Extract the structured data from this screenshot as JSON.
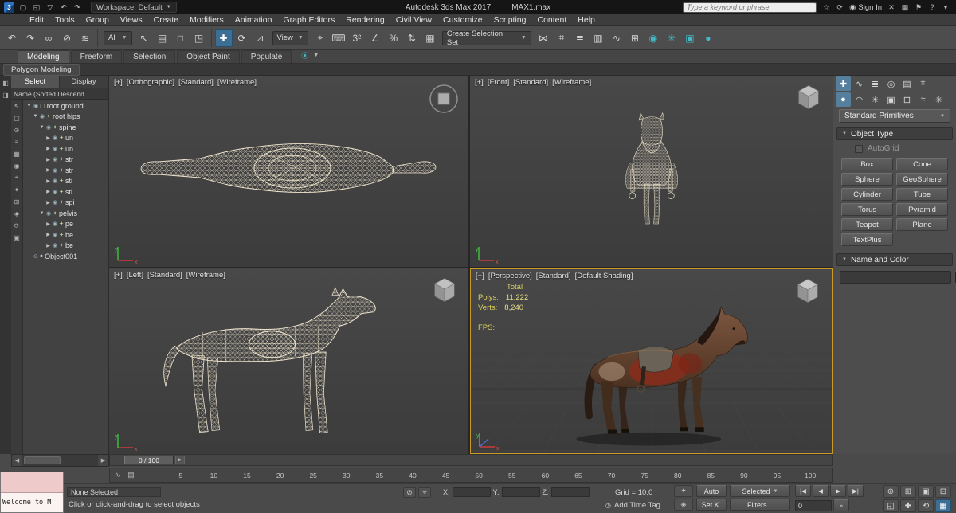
{
  "colors": {
    "active_viewport_border": "#c99b26",
    "wireframe": "#efe4cd",
    "stats_text": "#ddd25e",
    "name_color_swatch": "#e8559c"
  },
  "title_bar": {
    "logo_text": "3",
    "workspace_label": "Workspace: Default",
    "app_title": "Autodesk 3ds Max 2017",
    "file_name": "MAX1.max",
    "search_placeholder": "Type a keyword or phrase",
    "sign_in_label": "Sign In",
    "quick_icons": [
      {
        "name": "new-file-icon",
        "glyph": "▢"
      },
      {
        "name": "open-file-icon",
        "glyph": "◱"
      },
      {
        "name": "save-icon",
        "glyph": "▽"
      },
      {
        "name": "undo-quick-icon",
        "glyph": "↶"
      },
      {
        "name": "redo-quick-icon",
        "glyph": "↷"
      }
    ],
    "right_icons": [
      {
        "name": "favorites-icon",
        "glyph": "☆"
      },
      {
        "name": "sync-icon",
        "glyph": "⟳"
      }
    ],
    "right_icons2": [
      {
        "name": "exchange-icon",
        "glyph": "✕"
      },
      {
        "name": "apps-icon",
        "glyph": "▦"
      },
      {
        "name": "notification-icon",
        "glyph": "⚑"
      },
      {
        "name": "help-icon",
        "glyph": "?"
      },
      {
        "name": "title-dropdown-icon",
        "glyph": "▾"
      }
    ]
  },
  "menu_bar": {
    "items": [
      "Edit",
      "Tools",
      "Group",
      "Views",
      "Create",
      "Modifiers",
      "Animation",
      "Graph Editors",
      "Rendering",
      "Civil View",
      "Customize",
      "Scripting",
      "Content",
      "Help"
    ]
  },
  "toolbar": {
    "selection_filter_value": "All",
    "view_value": "View",
    "selection_set_value": "Create Selection Set",
    "icons_a": [
      {
        "name": "undo-icon",
        "glyph": "↶"
      },
      {
        "name": "redo-icon",
        "glyph": "↷"
      },
      {
        "name": "select-and-link-icon",
        "glyph": "∞"
      },
      {
        "name": "unlink-selection-icon",
        "glyph": "⊘"
      },
      {
        "name": "bind-to-space-warp-icon",
        "glyph": "≋"
      }
    ],
    "icons_b": [
      {
        "name": "select-object-icon",
        "glyph": "↖"
      },
      {
        "name": "select-by-name-icon",
        "glyph": "▤"
      },
      {
        "name": "selection-region-icon",
        "glyph": "□"
      },
      {
        "name": "window-crossing-icon",
        "glyph": "◳"
      }
    ],
    "icons_c": [
      {
        "name": "select-and-move-icon",
        "glyph": "✚",
        "cls": "active"
      },
      {
        "name": "select-and-rotate-icon",
        "glyph": "⟳"
      },
      {
        "name": "select-and-scale-icon",
        "glyph": "⊿"
      }
    ],
    "icons_d": [
      {
        "name": "select-and-manipulate-icon",
        "glyph": "⌖"
      },
      {
        "name": "keyboard-override-icon",
        "glyph": "⌨"
      },
      {
        "name": "snap-toggle-3d-icon",
        "glyph": "3²"
      },
      {
        "name": "angle-snap-icon",
        "glyph": "∠"
      },
      {
        "name": "percent-snap-icon",
        "glyph": "%"
      },
      {
        "name": "spinner-snap-icon",
        "glyph": "⇅"
      },
      {
        "name": "named-selection-sets-icon",
        "glyph": "▦"
      }
    ],
    "icons_e": [
      {
        "name": "mirror-icon",
        "glyph": "⋈"
      },
      {
        "name": "align-icon",
        "glyph": "⌗"
      },
      {
        "name": "layer-manager-icon",
        "glyph": "≣"
      },
      {
        "name": "ribbon-toggle-icon",
        "glyph": "▥"
      },
      {
        "name": "curve-editor-icon",
        "glyph": "∿"
      },
      {
        "name": "schematic-view-icon",
        "glyph": "⊞"
      },
      {
        "name": "material-editor-icon",
        "glyph": "◉",
        "cls": "teal"
      },
      {
        "name": "render-setup-icon",
        "glyph": "✳",
        "cls": "teal"
      },
      {
        "name": "rendered-frame-icon",
        "glyph": "▣",
        "cls": "teal"
      },
      {
        "name": "render-production-icon",
        "glyph": "●",
        "cls": "teal"
      }
    ]
  },
  "ribbon": {
    "tabs": [
      {
        "name": "tab-modeling",
        "label": "Modeling",
        "cls": "active"
      },
      {
        "name": "tab-freeform",
        "label": "Freeform"
      },
      {
        "name": "tab-selection",
        "label": "Selection"
      },
      {
        "name": "tab-object-paint",
        "label": "Object Paint"
      },
      {
        "name": "tab-populate",
        "label": "Populate"
      }
    ],
    "collapsed_panel": "Polygon Modeling"
  },
  "scene_explorer": {
    "tabs": [
      "Select",
      "Display"
    ],
    "column_header": "Name (Sorted Descend",
    "tools": [
      {
        "name": "explorer-select-icon",
        "glyph": "↖"
      },
      {
        "name": "explorer-rectangle-icon",
        "glyph": "▢"
      },
      {
        "name": "explorer-select-none-icon",
        "glyph": "⊘"
      },
      {
        "name": "explorer-list-icon",
        "glyph": "≡"
      },
      {
        "name": "explorer-display-icon",
        "glyph": "▦"
      },
      {
        "name": "explorer-eye-icon",
        "glyph": "◉"
      },
      {
        "name": "explorer-pick-icon",
        "glyph": "⌖"
      },
      {
        "name": "explorer-bone-filter-icon",
        "glyph": "✦"
      },
      {
        "name": "explorer-helper-filter-icon",
        "glyph": "⊞"
      },
      {
        "name": "explorer-pin-icon",
        "glyph": "◈"
      },
      {
        "name": "explorer-sync-icon",
        "glyph": "⟳"
      },
      {
        "name": "explorer-lock-icon",
        "glyph": "▣"
      }
    ],
    "rows": [
      "root ground",
      "root hips",
      "spine",
      "un",
      "un",
      "str",
      "str",
      "sti",
      "sti",
      "spi",
      "pelvis",
      "pe",
      "be",
      "be",
      "Object001"
    ]
  },
  "viewports": {
    "top_left": {
      "menus": [
        "[+]",
        "[Orthographic]",
        "[Standard]",
        "[Wireframe]"
      ]
    },
    "top_right": {
      "menus": [
        "[+]",
        "[Front]",
        "[Standard]",
        "[Wireframe]"
      ]
    },
    "bottom_left": {
      "menus": [
        "[+]",
        "[Left]",
        "[Standard]",
        "[Wireframe]"
      ]
    },
    "bottom_right": {
      "menus": [
        "[+]",
        "[Perspective]",
        "[Standard]",
        "[Default Shading]"
      ]
    },
    "stats": {
      "total_label": "Total",
      "polys_label": "Polys:",
      "polys": "11,222",
      "verts_label": "Verts:",
      "verts": "8,240",
      "fps_label": "FPS:"
    }
  },
  "command_panel": {
    "tabs": [
      {
        "name": "create-tab-icon",
        "glyph": "✚",
        "cls": "active"
      },
      {
        "name": "modify-tab-icon",
        "glyph": "∿"
      },
      {
        "name": "hierarchy-tab-icon",
        "glyph": "≣"
      },
      {
        "name": "motion-tab-icon",
        "glyph": "◎"
      },
      {
        "name": "display-tab-icon",
        "glyph": "▤"
      },
      {
        "name": "utilities-tab-icon",
        "glyph": "⌗"
      }
    ],
    "categories": [
      {
        "name": "geometry-category-icon",
        "glyph": "●",
        "cls": "active"
      },
      {
        "name": "shapes-category-icon",
        "glyph": "◠"
      },
      {
        "name": "lights-category-icon",
        "glyph": "☀"
      },
      {
        "name": "cameras-category-icon",
        "glyph": "▣"
      },
      {
        "name": "helpers-category-icon",
        "glyph": "⊞"
      },
      {
        "name": "space-warps-category-icon",
        "glyph": "≈"
      },
      {
        "name": "systems-category-icon",
        "glyph": "✳"
      }
    ],
    "dropdown_value": "Standard Primitives",
    "object_type_rollout": "Object Type",
    "autogrid_label": "AutoGrid",
    "buttons": [
      "Box",
      "Cone",
      "Sphere",
      "GeoSphere",
      "Cylinder",
      "Tube",
      "Torus",
      "Pyramid",
      "Teapot",
      "Plane",
      "TextPlus"
    ],
    "name_color_rollout": "Name and Color",
    "name_value": ""
  },
  "timeline": {
    "slider_value": "0 / 100",
    "ticks": [
      "5",
      "10",
      "15",
      "20",
      "25",
      "30",
      "35",
      "40",
      "45",
      "50",
      "55",
      "60",
      "65",
      "70",
      "75",
      "80",
      "85",
      "90",
      "95",
      "100"
    ],
    "trackbar_icons": [
      {
        "name": "mini-curve-editor-icon",
        "glyph": "∿"
      },
      {
        "name": "trackbar-filter-icon",
        "glyph": "▤"
      }
    ]
  },
  "status_bar": {
    "listener_text": "Welcome to M",
    "selection_status": "None Selected",
    "prompt": "Click or click-and-drag to select objects",
    "x_label": "X:",
    "y_label": "Y:",
    "z_label": "Z:",
    "x_value": "",
    "y_value": "",
    "z_value": "",
    "grid_label": "Grid = 10.0",
    "add_time_tag": "Add Time Tag",
    "auto_key": "Auto",
    "selected_set": "Selected",
    "set_key": "Set K.",
    "key_filters": "Filters...",
    "frame_value": "0",
    "lock_icons": [
      {
        "name": "selection-lock-icon",
        "glyph": "⊘"
      },
      {
        "name": "absolute-offset-icon",
        "glyph": "⌖"
      }
    ],
    "key_icons": [
      {
        "name": "set-keys-button",
        "glyph": "✦"
      },
      {
        "name": "key-mode-button",
        "glyph": "◈"
      }
    ],
    "playback": [
      {
        "name": "go-to-start-icon",
        "glyph": "|◀"
      },
      {
        "name": "previous-frame-icon",
        "glyph": "◀"
      },
      {
        "name": "play-icon",
        "glyph": "▶"
      },
      {
        "name": "go-to-end-icon",
        "glyph": "▶|"
      }
    ],
    "nav": [
      {
        "name": "zoom-icon",
        "glyph": "⊕"
      },
      {
        "name": "zoom-all-icon",
        "glyph": "⊞"
      },
      {
        "name": "zoom-extents-icon",
        "glyph": "▣"
      },
      {
        "name": "zoom-extents-all-icon",
        "glyph": "⊟"
      },
      {
        "name": "zoom-region-icon",
        "glyph": "◱"
      },
      {
        "name": "pan-icon",
        "glyph": "✚"
      },
      {
        "name": "orbit-icon",
        "glyph": "⟲"
      },
      {
        "name": "maximize-viewport-icon",
        "glyph": "▦",
        "cls": "active"
      }
    ]
  }
}
